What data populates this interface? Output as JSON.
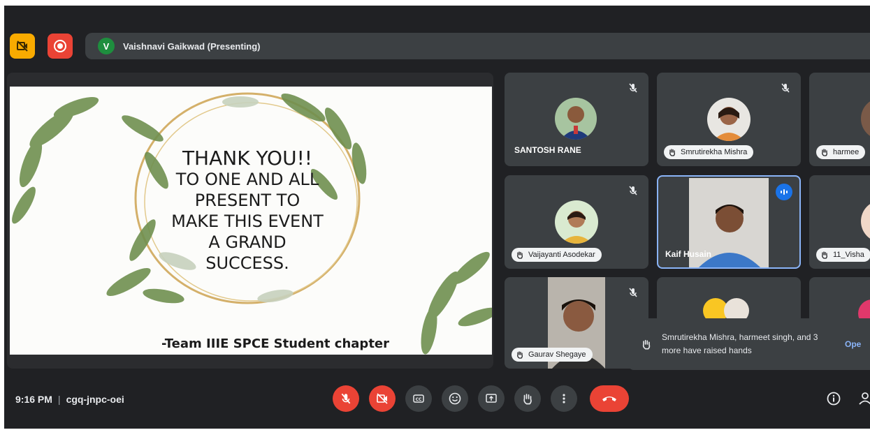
{
  "presenting": {
    "initial": "V",
    "label": "Vaishnavi Gaikwad (Presenting)"
  },
  "slide": {
    "line1": "THANK YOU!!",
    "line2": "TO ONE AND ALL",
    "line3": "PRESENT TO",
    "line4": "MAKE THIS EVENT",
    "line5": "A GRAND",
    "line6": "SUCCESS.",
    "team": "-Team IIIE SPCE Student chapter"
  },
  "participants": [
    {
      "name": "SANTOSH RANE"
    },
    {
      "name": "Smrutirekha Mishra"
    },
    {
      "name": "harmee"
    },
    {
      "name": "Vaijayanti Asodekar"
    },
    {
      "name": "Kaif Husain"
    },
    {
      "name": "11_Visha"
    },
    {
      "name": "Gaurav Shegaye"
    }
  ],
  "notification": {
    "text": "Smrutirekha Mishra, harmeet singh, and 3 more have raised hands",
    "action": "Ope"
  },
  "meeting": {
    "time": "9:16 PM",
    "code": "cgq-jnpc-oei"
  },
  "colors": {
    "danger": "#ea4335",
    "accent": "#8ab4f8",
    "tile": "#3c4043",
    "speaking": "#8ab4f8"
  }
}
